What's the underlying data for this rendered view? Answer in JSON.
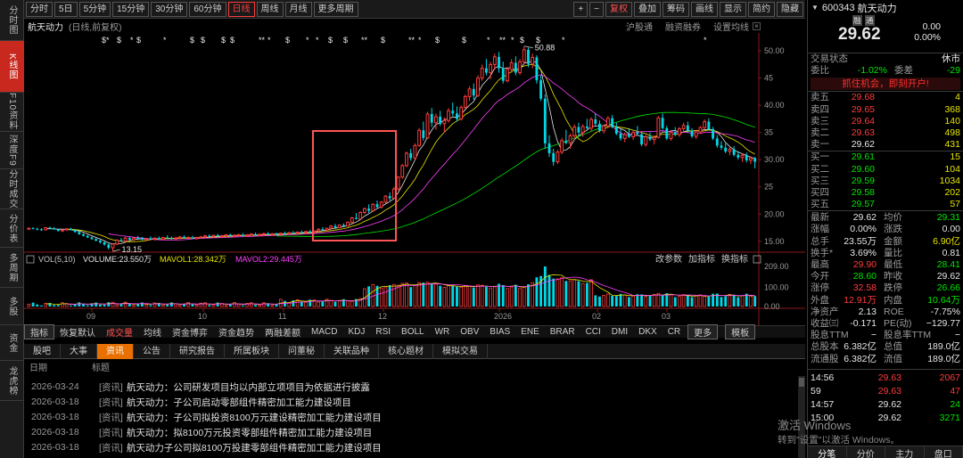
{
  "left_nav": [
    {
      "label": "分时图",
      "active": false
    },
    {
      "label": "K线图",
      "active": true
    },
    {
      "label": "F10资料",
      "active": false
    },
    {
      "label": "深度F9",
      "active": false
    },
    {
      "label": "分时成交",
      "active": false
    },
    {
      "label": "分价表",
      "active": false
    },
    {
      "label": "多周期",
      "active": false
    },
    {
      "label": "多股",
      "active": false
    },
    {
      "label": "资金",
      "active": false
    },
    {
      "label": "龙虎榜",
      "active": false
    }
  ],
  "toolbar": {
    "periods": [
      "分时",
      "5日",
      "5分钟",
      "15分钟",
      "30分钟",
      "60分钟",
      "日线",
      "周线",
      "月线",
      "更多周期"
    ],
    "active_period": "日线",
    "right_buttons": [
      "+",
      "−",
      "复权",
      "叠加",
      "筹码",
      "画线",
      "显示",
      "简约",
      "隐藏"
    ]
  },
  "chart_header": {
    "name": "航天动力",
    "mode": "(日线,前复权)",
    "links": [
      "沪股通",
      "融资融券",
      "设置均线"
    ]
  },
  "price_axis": [
    "50.00",
    "45",
    "40.00",
    "35",
    "30.00",
    "25",
    "20.00",
    "15.00"
  ],
  "annotations": {
    "high": "50.88",
    "low": "13.15"
  },
  "volume_header": {
    "label": "VOL(5,10)",
    "volume": "VOLUME:23.550万",
    "mavol1": "MAVOL1:28.342万",
    "mavol2": "MAVOL2:29.445万",
    "buttons": [
      "改参数",
      "加指标",
      "换指标"
    ]
  },
  "volume_axis": [
    "209.00",
    "100.00",
    "0.00"
  ],
  "x_axis": [
    "09",
    "10",
    "11",
    "12",
    "2026",
    "02",
    "03"
  ],
  "indicator_tabs": [
    "指标",
    "恢复默认",
    "成交量",
    "均线",
    "资金博弈",
    "资金趋势",
    "两融差额",
    "MACD",
    "KDJ",
    "RSI",
    "BOLL",
    "WR",
    "OBV",
    "BIAS",
    "ENE",
    "BRAR",
    "CCI",
    "DMI",
    "DKX",
    "CR",
    "更多",
    "模板"
  ],
  "news_tabs": [
    "股吧",
    "大事",
    "资讯",
    "公告",
    "研究报告",
    "所属板块",
    "问董秘",
    "关联品种",
    "核心题材",
    "模拟交易"
  ],
  "news_active": "资讯",
  "news_header": {
    "date": "日期",
    "title": "标题"
  },
  "news": [
    {
      "date": "2026-03-24",
      "tag": "[资讯]",
      "title": "航天动力：公司研发项目均以内部立项项目为依据进行披露"
    },
    {
      "date": "2026-03-18",
      "tag": "[资讯]",
      "title": "航天动力：子公司启动零部组件精密加工能力建设项目"
    },
    {
      "date": "2026-03-18",
      "tag": "[资讯]",
      "title": "航天动力：子公司拟投资8100万元建设精密加工能力建设项目"
    },
    {
      "date": "2026-03-18",
      "tag": "[资讯]",
      "title": "航天动力：拟8100万元投资零部组件精密加工能力建设项目"
    },
    {
      "date": "2026-03-18",
      "tag": "[资讯]",
      "title": "航天动力子公司拟8100万投建零部组件精密加工能力建设项目"
    }
  ],
  "quote": {
    "code": "600343",
    "name": "航天动力",
    "tags": [
      "融",
      "通"
    ],
    "price": "29.62",
    "change": "0.00",
    "pct": "0.00%",
    "trade_status_label": "交易状态",
    "trade_status": "休市",
    "weibi_label": "委比",
    "weibi": "-1.02%",
    "weicha_label": "委差",
    "weicha": "-29",
    "banner": "抓住机会，即刻开户!",
    "sells": [
      [
        "卖五",
        "29.68",
        "4"
      ],
      [
        "卖四",
        "29.65",
        "368"
      ],
      [
        "卖三",
        "29.64",
        "140"
      ],
      [
        "卖二",
        "29.63",
        "498"
      ],
      [
        "卖一",
        "29.62",
        "431"
      ]
    ],
    "buys": [
      [
        "买一",
        "29.61",
        "15"
      ],
      [
        "买二",
        "29.60",
        "104"
      ],
      [
        "买三",
        "29.59",
        "1034"
      ],
      [
        "买四",
        "29.58",
        "202"
      ],
      [
        "买五",
        "29.57",
        "57"
      ]
    ],
    "stats": [
      [
        "最新",
        "29.62",
        "均价",
        "29.31"
      ],
      [
        "涨幅",
        "0.00%",
        "涨跌",
        "0.00"
      ],
      [
        "总手",
        "23.55万",
        "金额",
        "6.90亿"
      ],
      [
        "换手*",
        "3.69%",
        "量比",
        "0.81"
      ],
      [
        "最高",
        "29.90",
        "最低",
        "28.41"
      ],
      [
        "今开",
        "28.60",
        "昨收",
        "29.62"
      ],
      [
        "涨停",
        "32.58",
        "跌停",
        "26.66"
      ],
      [
        "外盘",
        "12.91万",
        "内盘",
        "10.64万"
      ],
      [
        "净资产",
        "2.13",
        "ROE",
        "-7.75%"
      ],
      [
        "收益㈢",
        "-0.171",
        "PE(动)",
        "−129.77"
      ],
      [
        "股息TTM",
        "−",
        "股息率TTM",
        "−"
      ],
      [
        "总股本",
        "6.382亿",
        "总值",
        "189.0亿"
      ],
      [
        "流通股",
        "6.382亿",
        "流值",
        "189.0亿"
      ]
    ],
    "ticks": [
      [
        "14:56",
        "29.63",
        "2067"
      ],
      [
        "59",
        "29.63",
        "47"
      ],
      [
        "14:57",
        "29.62",
        "24"
      ],
      [
        "15:00",
        "29.62",
        "3271"
      ]
    ],
    "bottom_tabs": [
      "分笔",
      "分价",
      "主力",
      "盘口"
    ]
  },
  "watermark": {
    "line1": "激活 Windows",
    "line2": "转到\"设置\"以激活 Windows。"
  },
  "chart_data": {
    "type": "candlestick",
    "title": "航天动力 (日线,前复权)",
    "x_ticks": [
      "09",
      "10",
      "11",
      "12",
      "2026",
      "02",
      "03"
    ],
    "ylim": [
      13,
      51
    ],
    "candles": [
      [
        17.3,
        17.5,
        17.1,
        17.4
      ],
      [
        17.4,
        17.6,
        17.2,
        17.3
      ],
      [
        17.3,
        17.5,
        17.0,
        17.2
      ],
      [
        17.2,
        17.4,
        16.9,
        17.1
      ],
      [
        17.1,
        17.6,
        17.0,
        17.5
      ],
      [
        17.5,
        17.7,
        17.3,
        17.4
      ],
      [
        17.4,
        17.6,
        17.1,
        17.2
      ],
      [
        17.2,
        17.3,
        16.8,
        16.9
      ],
      [
        16.9,
        17.2,
        16.7,
        17.1
      ],
      [
        17.1,
        17.4,
        16.9,
        17.3
      ],
      [
        17.3,
        17.5,
        17.0,
        17.1
      ],
      [
        17.1,
        17.2,
        16.6,
        16.7
      ],
      [
        16.7,
        16.9,
        16.2,
        16.3
      ],
      [
        16.3,
        16.5,
        15.9,
        16.0
      ],
      [
        16.0,
        16.2,
        15.6,
        15.7
      ],
      [
        15.7,
        15.9,
        15.3,
        15.4
      ],
      [
        15.4,
        15.6,
        15.0,
        15.1
      ],
      [
        15.1,
        15.3,
        14.6,
        14.8
      ],
      [
        14.8,
        15.0,
        14.2,
        14.4
      ],
      [
        14.4,
        14.6,
        13.5,
        13.8
      ],
      [
        13.8,
        14.6,
        13.15,
        14.5
      ],
      [
        14.5,
        15.4,
        14.3,
        15.2
      ],
      [
        15.2,
        15.6,
        14.9,
        15.0
      ],
      [
        15.0,
        15.8,
        14.9,
        15.6
      ],
      [
        15.6,
        15.9,
        15.2,
        15.3
      ],
      [
        15.3,
        15.7,
        15.1,
        15.6
      ],
      [
        15.6,
        16.0,
        15.4,
        15.5
      ],
      [
        15.5,
        15.8,
        15.2,
        15.3
      ],
      [
        15.3,
        15.6,
        15.0,
        15.5
      ],
      [
        15.5,
        15.9,
        15.3,
        15.4
      ],
      [
        15.4,
        15.7,
        15.1,
        15.6
      ],
      [
        15.6,
        15.9,
        15.3,
        15.4
      ],
      [
        15.4,
        15.8,
        15.2,
        15.7
      ],
      [
        15.7,
        16.1,
        15.5,
        15.6
      ],
      [
        15.6,
        15.9,
        15.3,
        15.5
      ],
      [
        15.5,
        15.8,
        15.2,
        15.6
      ],
      [
        15.6,
        16.0,
        15.4,
        15.8
      ],
      [
        15.8,
        16.1,
        15.5,
        15.6
      ],
      [
        15.6,
        15.9,
        15.4,
        15.7
      ],
      [
        15.7,
        16.0,
        15.4,
        15.5
      ],
      [
        15.5,
        15.8,
        15.3,
        15.7
      ],
      [
        15.7,
        16.0,
        15.5,
        15.8
      ],
      [
        15.8,
        16.2,
        15.6,
        16.0
      ],
      [
        16.0,
        16.3,
        15.7,
        15.9
      ],
      [
        15.9,
        16.2,
        15.6,
        16.1
      ],
      [
        16.1,
        16.4,
        15.8,
        15.9
      ],
      [
        15.9,
        16.2,
        15.6,
        16.0
      ],
      [
        16.0,
        16.3,
        15.8,
        16.2
      ],
      [
        16.2,
        16.4,
        15.9,
        16.0
      ],
      [
        16.0,
        16.3,
        15.8,
        16.1
      ],
      [
        16.1,
        16.4,
        15.9,
        16.2
      ],
      [
        16.2,
        16.5,
        15.9,
        16.0
      ],
      [
        16.0,
        16.3,
        15.8,
        16.2
      ],
      [
        16.2,
        16.5,
        16.0,
        16.3
      ],
      [
        16.3,
        16.6,
        16.0,
        16.1
      ],
      [
        16.1,
        16.4,
        15.9,
        16.3
      ],
      [
        16.3,
        16.6,
        16.1,
        16.4
      ],
      [
        16.4,
        16.7,
        16.1,
        16.2
      ],
      [
        16.2,
        16.5,
        16.0,
        16.4
      ],
      [
        16.4,
        16.6,
        16.1,
        16.3
      ],
      [
        16.3,
        16.6,
        16.0,
        16.5
      ],
      [
        16.5,
        16.8,
        16.2,
        16.4
      ],
      [
        16.4,
        16.7,
        16.2,
        16.6
      ],
      [
        16.6,
        16.9,
        16.3,
        16.5
      ],
      [
        16.5,
        16.8,
        16.3,
        16.7
      ],
      [
        16.7,
        17.0,
        16.4,
        16.6
      ],
      [
        16.6,
        16.9,
        16.4,
        16.8
      ],
      [
        16.8,
        17.1,
        16.5,
        16.7
      ],
      [
        16.7,
        17.0,
        16.5,
        16.9
      ],
      [
        16.9,
        17.4,
        16.7,
        17.2
      ],
      [
        17.2,
        17.6,
        17.0,
        17.1
      ],
      [
        17.1,
        17.5,
        16.8,
        17.4
      ],
      [
        17.4,
        18.0,
        17.2,
        17.8
      ],
      [
        17.8,
        18.2,
        17.3,
        17.5
      ],
      [
        17.5,
        18.1,
        17.4,
        18.0
      ],
      [
        18.0,
        18.3,
        17.6,
        17.8
      ],
      [
        17.8,
        18.6,
        17.7,
        18.5
      ],
      [
        18.5,
        19.5,
        18.3,
        19.3
      ],
      [
        19.3,
        20.2,
        19.0,
        19.1
      ],
      [
        19.1,
        20.5,
        19.0,
        20.3
      ],
      [
        20.3,
        21.2,
        20.0,
        21.0
      ],
      [
        21.0,
        21.8,
        20.2,
        20.6
      ],
      [
        20.6,
        22.0,
        20.4,
        21.8
      ],
      [
        21.8,
        22.5,
        21.0,
        21.3
      ],
      [
        21.3,
        22.4,
        21.0,
        22.2
      ],
      [
        22.2,
        23.5,
        22.0,
        23.3
      ],
      [
        23.3,
        24.0,
        22.5,
        22.9
      ],
      [
        22.9,
        25.0,
        22.7,
        24.6
      ],
      [
        24.6,
        27.0,
        24.4,
        26.8
      ],
      [
        26.8,
        29.2,
        26.5,
        28.9
      ],
      [
        28.9,
        31.5,
        28.6,
        31.2
      ],
      [
        31.2,
        32.0,
        29.8,
        30.3
      ],
      [
        30.3,
        33.0,
        30.0,
        32.6
      ],
      [
        32.6,
        35.8,
        32.4,
        35.4
      ],
      [
        35.4,
        37.0,
        33.5,
        34.0
      ],
      [
        34.0,
        38.8,
        33.8,
        38.4
      ],
      [
        38.4,
        39.5,
        36.0,
        36.8
      ],
      [
        36.8,
        38.5,
        35.5,
        37.9
      ],
      [
        37.9,
        39.0,
        36.2,
        36.6
      ],
      [
        36.6,
        37.8,
        35.0,
        37.2
      ],
      [
        37.2,
        39.5,
        36.8,
        39.0
      ],
      [
        39.0,
        40.5,
        38.0,
        38.5
      ],
      [
        38.5,
        39.8,
        37.0,
        37.5
      ],
      [
        37.5,
        40.0,
        37.2,
        39.6
      ],
      [
        39.6,
        42.0,
        39.4,
        41.6
      ],
      [
        41.6,
        43.5,
        40.8,
        43.0
      ],
      [
        43.0,
        44.0,
        41.0,
        41.8
      ],
      [
        41.8,
        45.5,
        41.5,
        45.0
      ],
      [
        45.0,
        47.5,
        44.5,
        46.8
      ],
      [
        46.8,
        48.5,
        45.5,
        46.0
      ],
      [
        46.0,
        48.0,
        44.8,
        47.5
      ],
      [
        47.5,
        49.5,
        46.5,
        48.9
      ],
      [
        48.9,
        49.8,
        46.0,
        46.8
      ],
      [
        46.8,
        48.0,
        44.0,
        44.5
      ],
      [
        44.5,
        47.0,
        44.2,
        46.6
      ],
      [
        46.6,
        48.5,
        46.0,
        47.8
      ],
      [
        47.8,
        49.0,
        45.5,
        46.0
      ],
      [
        46.0,
        48.5,
        45.6,
        48.0
      ],
      [
        48.0,
        50.88,
        47.5,
        50.2
      ],
      [
        50.2,
        50.6,
        47.0,
        47.6
      ],
      [
        47.6,
        49.5,
        46.8,
        48.8
      ],
      [
        48.8,
        49.2,
        44.0,
        44.6
      ],
      [
        44.6,
        45.5,
        40.8,
        41.2
      ],
      [
        41.2,
        42.0,
        32.0,
        33.0
      ],
      [
        33.0,
        34.5,
        30.5,
        31.2
      ],
      [
        31.2,
        32.0,
        28.9,
        29.6
      ],
      [
        29.6,
        31.8,
        29.2,
        31.4
      ],
      [
        31.4,
        34.0,
        31.0,
        33.5
      ],
      [
        33.5,
        35.5,
        32.8,
        33.1
      ],
      [
        33.1,
        34.8,
        32.0,
        34.4
      ],
      [
        34.4,
        36.5,
        33.9,
        36.0
      ],
      [
        36.0,
        36.8,
        34.5,
        35.0
      ],
      [
        35.0,
        36.5,
        34.2,
        36.1
      ],
      [
        36.1,
        37.5,
        35.5,
        35.8
      ],
      [
        35.8,
        37.8,
        35.2,
        37.4
      ],
      [
        37.4,
        38.5,
        36.2,
        36.6
      ],
      [
        36.6,
        37.2,
        35.0,
        35.3
      ],
      [
        35.3,
        36.5,
        34.8,
        36.2
      ],
      [
        36.2,
        38.0,
        35.8,
        37.6
      ],
      [
        37.6,
        38.2,
        35.8,
        36.0
      ],
      [
        36.0,
        36.8,
        34.5,
        34.8
      ],
      [
        34.8,
        35.6,
        33.5,
        33.9
      ],
      [
        33.9,
        35.0,
        33.2,
        34.6
      ],
      [
        34.6,
        35.8,
        34.0,
        34.2
      ],
      [
        34.2,
        35.4,
        33.6,
        35.0
      ],
      [
        35.0,
        36.2,
        34.5,
        34.7
      ],
      [
        34.7,
        35.0,
        32.5,
        32.8
      ],
      [
        32.8,
        34.6,
        32.4,
        34.2
      ],
      [
        34.2,
        35.0,
        33.4,
        33.7
      ],
      [
        33.7,
        34.5,
        32.8,
        34.1
      ],
      [
        34.1,
        38.0,
        33.9,
        37.7
      ],
      [
        37.7,
        38.5,
        35.5,
        35.8
      ],
      [
        35.8,
        36.2,
        33.6,
        33.9
      ],
      [
        33.9,
        35.4,
        33.5,
        35.0
      ],
      [
        35.0,
        36.0,
        34.3,
        34.6
      ],
      [
        34.6,
        36.0,
        34.2,
        35.7
      ],
      [
        35.7,
        36.8,
        35.2,
        36.3
      ],
      [
        36.3,
        37.0,
        35.0,
        35.3
      ],
      [
        35.3,
        35.8,
        34.0,
        34.3
      ],
      [
        34.3,
        35.5,
        33.8,
        35.1
      ],
      [
        35.1,
        36.2,
        34.8,
        35.9
      ],
      [
        35.9,
        37.4,
        35.6,
        37.0
      ],
      [
        37.0,
        37.6,
        35.4,
        35.6
      ],
      [
        35.6,
        36.0,
        33.6,
        33.9
      ],
      [
        33.9,
        34.5,
        32.2,
        32.6
      ],
      [
        32.6,
        33.4,
        31.8,
        32.2
      ],
      [
        32.2,
        33.0,
        31.2,
        31.5
      ],
      [
        31.5,
        32.4,
        30.8,
        31.9
      ],
      [
        31.9,
        32.5,
        30.6,
        30.9
      ],
      [
        30.9,
        31.6,
        30.0,
        30.4
      ],
      [
        30.4,
        31.2,
        29.6,
        30.8
      ],
      [
        30.8,
        31.3,
        29.5,
        29.9
      ],
      [
        29.9,
        30.6,
        29.2,
        30.3
      ],
      [
        30.3,
        30.5,
        28.4,
        29.62
      ]
    ]
  }
}
